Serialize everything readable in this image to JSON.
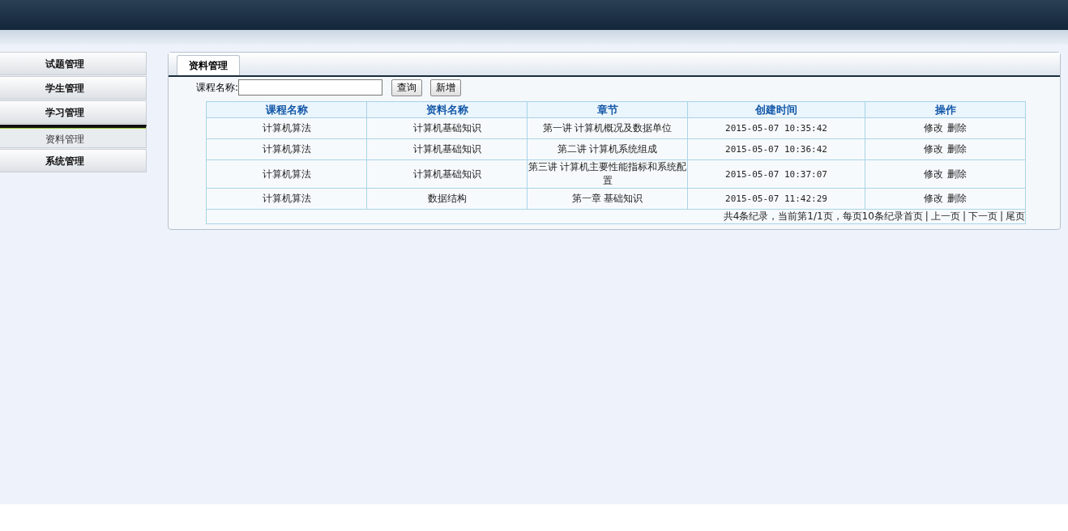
{
  "sidebar": {
    "items": [
      {
        "label": "试题管理",
        "kind": "group",
        "selected": false
      },
      {
        "label": "学生管理",
        "kind": "group",
        "selected": false
      },
      {
        "label": "学习管理",
        "kind": "group",
        "selected": false
      },
      {
        "label": "资料管理",
        "kind": "sub",
        "selected": true
      },
      {
        "label": "系统管理",
        "kind": "group",
        "selected": false
      }
    ]
  },
  "panel": {
    "tab": "资料管理",
    "search": {
      "label": "课程名称:"
    },
    "buttons": [
      "查询",
      "新增"
    ],
    "table": {
      "columns": [
        "课程名称",
        "资料名称",
        "章节",
        "创建时间",
        "操作"
      ],
      "rows": [
        {
          "cells": [
            "计算机算法",
            "计算机基础知识",
            "第一讲 计算机概况及数据单位",
            "2015-05-07 10:35:42"
          ],
          "actions": [
            "修改",
            "删除"
          ]
        },
        {
          "cells": [
            "计算机算法",
            "计算机基础知识",
            "第二讲 计算机系统组成",
            "2015-05-07 10:36:42"
          ],
          "actions": [
            "修改",
            "删除"
          ]
        },
        {
          "cells": [
            "计算机算法",
            "计算机基础知识",
            "第三讲 计算机主要性能指标和系统配置",
            "2015-05-07 10:37:07"
          ],
          "actions": [
            "修改",
            "删除"
          ]
        },
        {
          "cells": [
            "计算机算法",
            "数据结构",
            "第一章 基础知识",
            "2015-05-07 11:42:29"
          ],
          "actions": [
            "修改",
            "删除"
          ]
        }
      ],
      "pager": {
        "summary": "共4条纪录，当前第1/1页，每页10条纪录",
        "links": [
          "首页",
          "上一页",
          "下一页",
          "尾页"
        ],
        "separator": "|"
      }
    }
  }
}
